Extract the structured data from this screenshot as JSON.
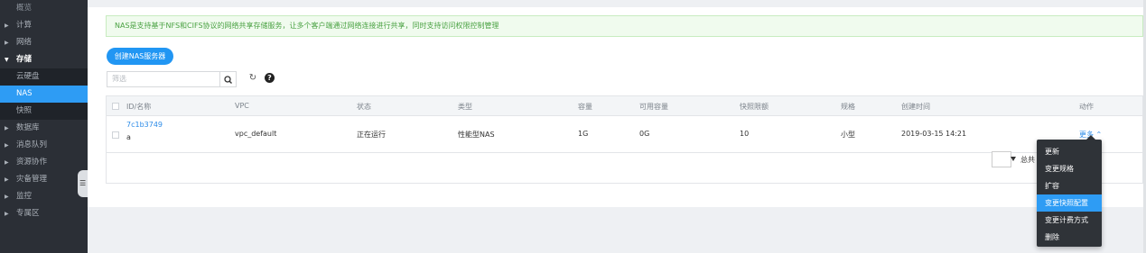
{
  "sidebar": {
    "items": [
      {
        "label": "概览",
        "level": "top"
      },
      {
        "label": "计算",
        "level": "group"
      },
      {
        "label": "网络",
        "level": "group"
      },
      {
        "label": "存储",
        "level": "open"
      },
      {
        "label": "云硬盘",
        "level": "sub"
      },
      {
        "label": "NAS",
        "level": "sub-active"
      },
      {
        "label": "快照",
        "level": "sub"
      },
      {
        "label": "数据库",
        "level": "group"
      },
      {
        "label": "消息队列",
        "level": "group"
      },
      {
        "label": "资源协作",
        "level": "group"
      },
      {
        "label": "灾备管理",
        "level": "group"
      },
      {
        "label": "监控",
        "level": "group"
      },
      {
        "label": "专属区",
        "level": "group"
      }
    ]
  },
  "notice": "NAS是支持基于NFS和CIFS协议的网络共享存储服务，让多个客户端通过网络连接进行共享，同时支持访问权限控制管理",
  "toolbar": {
    "create_label": "创建NAS服务器",
    "filter_placeholder": "筛选",
    "help_glyph": "?"
  },
  "table": {
    "columns": [
      "ID/名称",
      "VPC",
      "状态",
      "类型",
      "容量",
      "可用容量",
      "快照限额",
      "规格",
      "创建时间",
      "动作"
    ],
    "rows": [
      {
        "id": "7c1b3749",
        "name": "a",
        "vpc": "vpc_default",
        "status": "正在运行",
        "type": "性能型NAS",
        "capacity": "1G",
        "available": "0G",
        "snapshot_quota": "10",
        "spec": "小型",
        "created": "2019-03-15 14:21",
        "action": "更多 ⌃"
      }
    ]
  },
  "pager": {
    "total": "总共 1 条"
  },
  "action_menu": {
    "items": [
      "更新",
      "变更规格",
      "扩容",
      "变更快照配置",
      "变更计费方式",
      "删除"
    ],
    "highlighted": "变更快照配置"
  },
  "colors": {
    "accent": "#2196f3",
    "sidebar_bg": "#2b2f36",
    "notice_text": "#4aa243"
  }
}
